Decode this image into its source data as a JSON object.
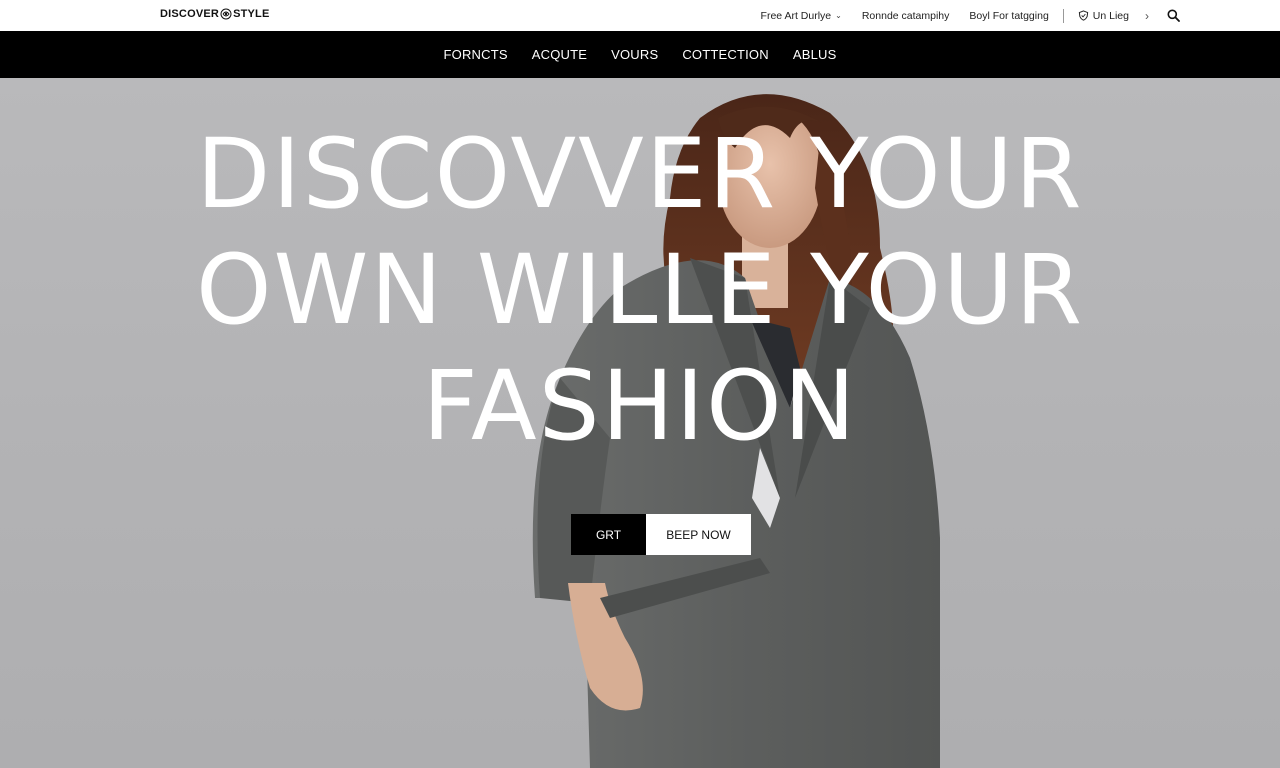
{
  "brand": {
    "logo_left": "DISCOVER",
    "logo_right": "STYLE"
  },
  "utility": {
    "links": [
      {
        "label": "Free Art Durlye",
        "has_caret": true
      },
      {
        "label": "Ronnde catampihy",
        "has_caret": false
      },
      {
        "label": "Boyl For tatgging",
        "has_caret": false
      }
    ],
    "account_label": "Un Lieg",
    "icons": [
      "shield-icon",
      "chevron-right-icon",
      "search-icon"
    ]
  },
  "nav": {
    "items": [
      "FORNCTS",
      "ACQUTE",
      "VOURS",
      "COTTECTION",
      "ABLUS"
    ]
  },
  "hero": {
    "headline": [
      "DISCOVVER YOUR",
      "OWN WILLE YOUR",
      "FASHION"
    ],
    "primary_button": "GRT",
    "secondary_button": "BEEP NOW"
  },
  "colors": {
    "nav_bg": "#000000",
    "hero_bg": "#b5b5b7",
    "headline": "#ffffff",
    "coat": "#5f6160",
    "hair": "#5a2e1c"
  }
}
